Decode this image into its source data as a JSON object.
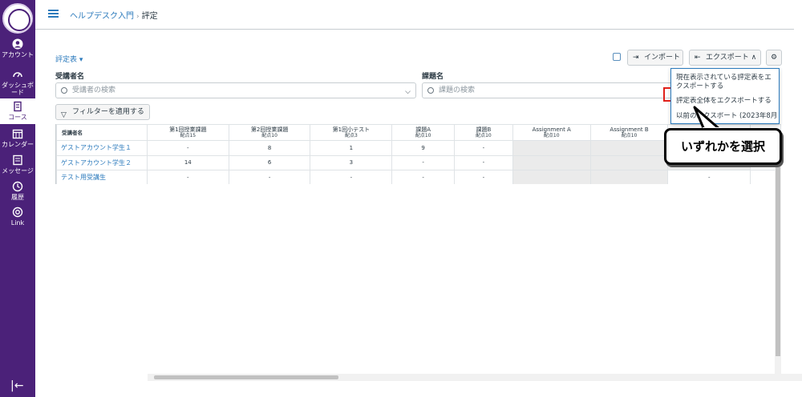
{
  "nav": {
    "items": [
      {
        "label": "アカウント",
        "icon": "account-icon"
      },
      {
        "label": "ダッシュボード",
        "icon": "dashboard-icon"
      },
      {
        "label": "コース",
        "icon": "courses-icon"
      },
      {
        "label": "カレンダー",
        "icon": "calendar-icon"
      },
      {
        "label": "メッセージ",
        "icon": "inbox-icon"
      },
      {
        "label": "履歴",
        "icon": "history-icon"
      },
      {
        "label": "Link",
        "icon": "link-icon"
      }
    ],
    "accent": "#4b2179"
  },
  "breadcrumb": {
    "course": "ヘルプデスク入門",
    "separator": "›",
    "current": "評定"
  },
  "toolbar": {
    "gradebook_menu": "評定表 ▾",
    "import_label": "インポート",
    "export_label": "エクスポート ∧"
  },
  "filters": {
    "student_label": "受講者名",
    "student_placeholder": "受講者の検索",
    "assignment_label": "課題名",
    "assignment_placeholder": "課題の検索",
    "apply_filter": "フィルターを適用する"
  },
  "grid": {
    "name_header": "受講者名",
    "columns": [
      {
        "title": "第1回授業課題",
        "points": "配点15"
      },
      {
        "title": "第2回授業課題",
        "points": "配点10"
      },
      {
        "title": "第1回小テスト",
        "points": "配点3"
      },
      {
        "title": "課題A",
        "points": "配点10"
      },
      {
        "title": "課題B",
        "points": "配点10"
      },
      {
        "title": "Assignment A",
        "points": "配点10"
      },
      {
        "title": "Assignment B",
        "points": "配点10"
      }
    ],
    "rows": [
      {
        "name": "ゲストアカウント学生１",
        "cells": [
          "-",
          "8",
          "1",
          "9",
          "-",
          "",
          ""
        ]
      },
      {
        "name": "ゲストアカウント学生２",
        "cells": [
          "14",
          "6",
          "3",
          "-",
          "-",
          "",
          ""
        ]
      },
      {
        "name": "テスト用受講生",
        "cells": [
          "-",
          "-",
          "-",
          "-",
          "-",
          "",
          ""
        ]
      }
    ],
    "extra_cell": "-"
  },
  "export_menu": {
    "items": [
      "現在表示されている評定表をエクスポートする",
      "評定表全体をエクスポートする",
      "以前のエクスポート (2023年8月"
    ]
  },
  "callout": {
    "text": "いずれかを選択"
  }
}
